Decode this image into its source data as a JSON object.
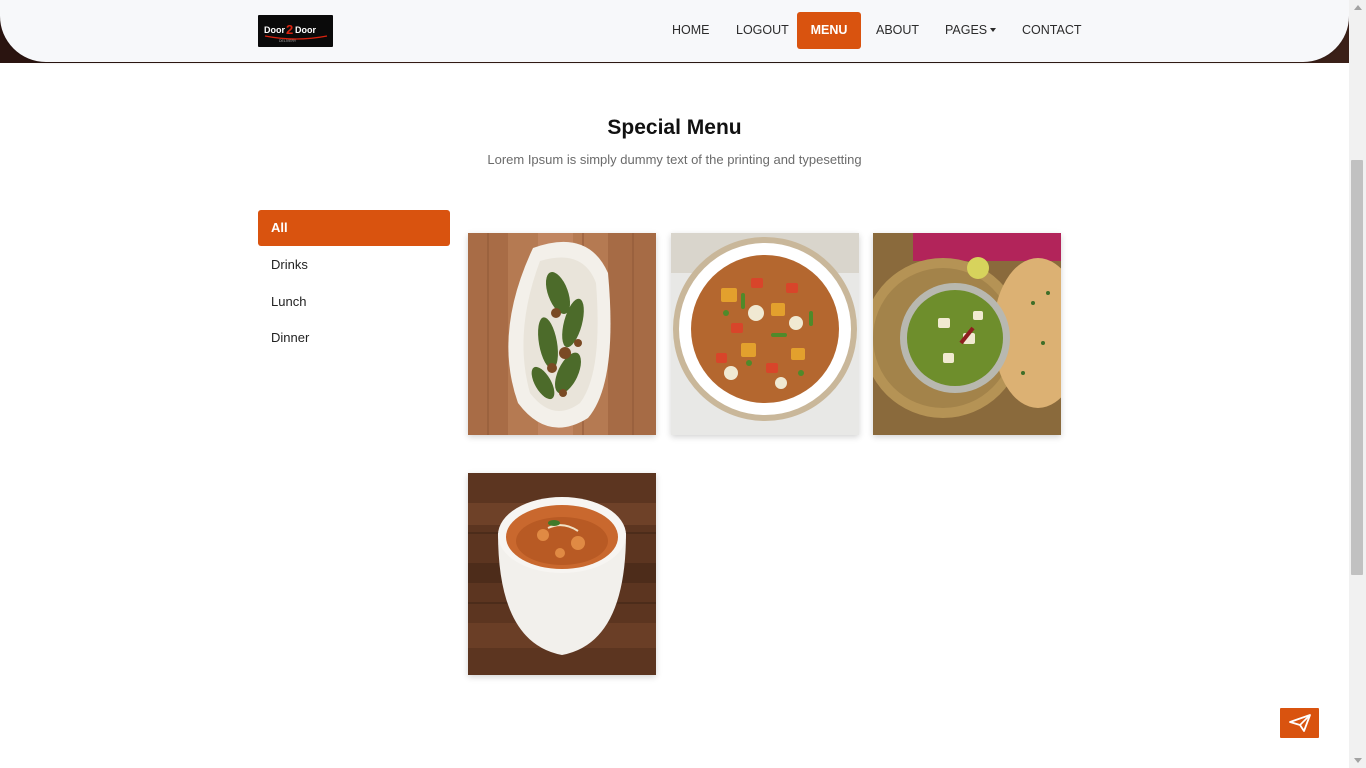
{
  "brand": {
    "logo_text": "Door2Door",
    "colors": {
      "accent": "#d9530f",
      "navbar_bg": "#f7f8fa"
    }
  },
  "nav": {
    "items": [
      {
        "label": "HOME"
      },
      {
        "label": "LOGOUT"
      },
      {
        "label": "MENU",
        "active": true
      },
      {
        "label": "ABOUT"
      },
      {
        "label": "PAGES",
        "dropdown": true
      },
      {
        "label": "CONTACT"
      }
    ]
  },
  "section": {
    "title": "Special Menu",
    "subtitle": "Lorem Ipsum is simply dummy text of the printing and typesetting"
  },
  "filters": [
    {
      "label": "All",
      "active": true
    },
    {
      "label": "Drinks"
    },
    {
      "label": "Lunch"
    },
    {
      "label": "Dinner"
    }
  ],
  "menu_items": [
    {
      "icon": "okra-dish-image"
    },
    {
      "icon": "mixed-veg-curry-image"
    },
    {
      "icon": "palak-paneer-image"
    },
    {
      "icon": "paneer-butter-masala-image"
    }
  ],
  "send_button": {
    "icon": "paper-plane-icon"
  }
}
